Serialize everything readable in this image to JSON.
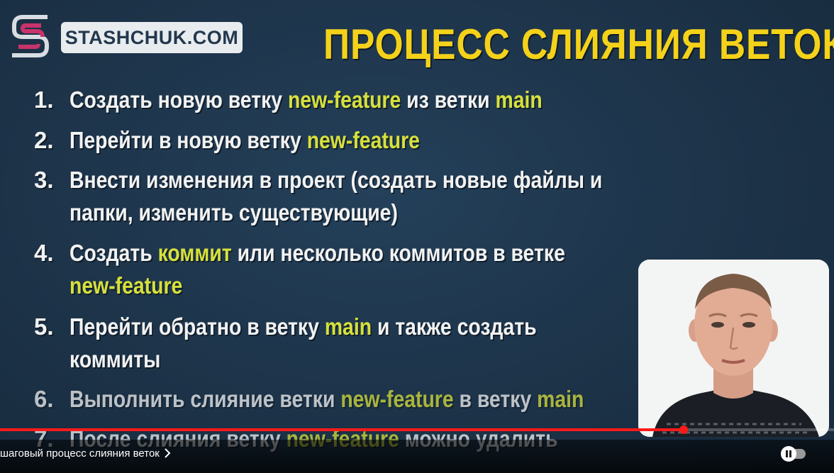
{
  "brand": {
    "name": "STASHCHUK.COM"
  },
  "slide": {
    "title": "ПРОЦЕСС СЛИЯНИЯ ВЕТОК",
    "steps": [
      {
        "num": "1.",
        "parts": [
          "Создать новую ветку ",
          "new-feature",
          " из ветки ",
          "main"
        ]
      },
      {
        "num": "2.",
        "parts": [
          "Перейти в новую ветку ",
          "new-feature"
        ]
      },
      {
        "num": "3.",
        "line1": "Внести изменения в проект (создать новые файлы и",
        "line2": "папки, изменить существующие)"
      },
      {
        "num": "4.",
        "parts": [
          "Создать ",
          "коммит",
          " или несколько коммитов в ветке"
        ],
        "line2": "new-feature"
      },
      {
        "num": "5.",
        "parts": [
          "Перейти обратно в ветку ",
          "main",
          " и также создать"
        ],
        "line2": "коммиты"
      },
      {
        "num": "6.",
        "parts": [
          "Выполнить слияние ветки ",
          "new-feature",
          " в ветку ",
          "main"
        ]
      },
      {
        "num": "7.",
        "parts": [
          "После слияния ветку ",
          "new-feature",
          " можно удалить"
        ]
      }
    ]
  },
  "player": {
    "chapter_title": "шаговый процесс слияния веток",
    "chevron_icon": "chevron-right-icon",
    "progress_fraction": 0.82,
    "accent_color": "#ff1a1a"
  },
  "colors": {
    "title": "#f5d21a",
    "highlight": "#d7e03c",
    "background": "#1f3348",
    "logo_pink": "#c8336b"
  }
}
